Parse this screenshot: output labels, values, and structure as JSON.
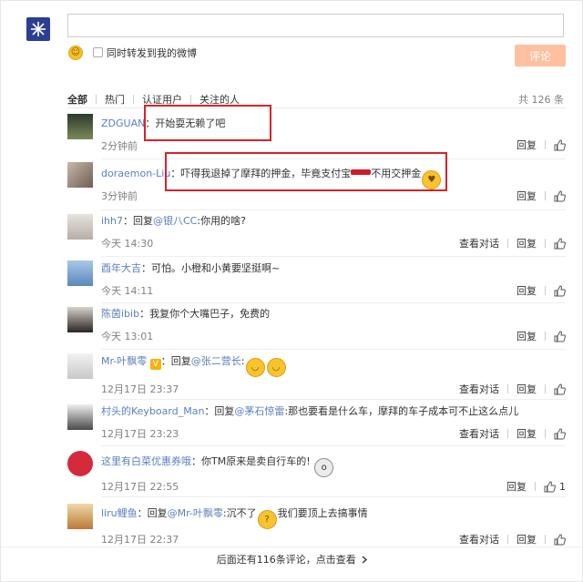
{
  "composer": {
    "textarea_value": "",
    "repost_label": "同时转发到我的微博",
    "repost_checked": false,
    "submit_label": "评论"
  },
  "tabs": [
    {
      "label": "全部"
    },
    {
      "label": "热门"
    },
    {
      "label": "认证用户"
    },
    {
      "label": "关注的人"
    }
  ],
  "total": "共 126 条",
  "reply_label": "回复",
  "conversation_label": "查看对话",
  "comments": [
    {
      "user": "ZDGUAN",
      "prefix": "：",
      "mention": "",
      "text": "开始耍无赖了吧",
      "time": "2分钟前",
      "has_conversation": false,
      "likes": ""
    },
    {
      "user": "doraemon-Liu",
      "prefix": "：",
      "mention": "",
      "text_a": "吓得我退掉了摩拜的押金，毕竟支付宝",
      "text_b": "不用交押金",
      "time": "3分钟前",
      "has_conversation": false,
      "likes": ""
    },
    {
      "user": "ihh7",
      "prefix": "：回复",
      "mention": "@银八CC",
      "text": ":你用的啥?",
      "time": "今天 14:30",
      "has_conversation": true,
      "likes": ""
    },
    {
      "user": "酉年大吉",
      "prefix": "：",
      "mention": "",
      "text": "可怕。小橙和小黄要坚挺啊~",
      "time": "今天 14:11",
      "has_conversation": false,
      "likes": ""
    },
    {
      "user": "陈茵ibib",
      "prefix": "：",
      "mention": "",
      "text": "我复你个大嘴巴子，免费的",
      "time": "今天 13:01",
      "has_conversation": false,
      "likes": ""
    },
    {
      "user": "Mr-叶飘零",
      "prefix": "：回复",
      "mention": "@张二营长",
      "text": ":",
      "time": "12月17日 23:37",
      "has_conversation": true,
      "likes": ""
    },
    {
      "user": "村头的Keyboard_Man",
      "prefix": "：回复",
      "mention": "@茅石惊雷",
      "text": ":那也要看是什么车，摩拜的车子成本可不止这么点儿",
      "time": "12月17日 23:23",
      "has_conversation": true,
      "likes": ""
    },
    {
      "user": "这里有白菜优惠券哦",
      "prefix": "：",
      "mention": "",
      "text": "你TM原来是卖自行车的!",
      "time": "12月17日 22:55",
      "has_conversation": false,
      "likes": "1"
    },
    {
      "user": "liru鲤鱼",
      "prefix": "：回复",
      "mention": "@Mr-叶飘零",
      "text_a": ":沉不了",
      "text_b": "我们要顶上去搞事情",
      "time": "12月17日 22:37",
      "has_conversation": true,
      "likes": ""
    }
  ],
  "more_label": "后面还有116条评论，点击查看",
  "colors": {
    "link": "#5b7fbd",
    "submit_disabled": "#ffc09f",
    "annotation": "#d8222a",
    "muted": "#808080"
  },
  "icons": [
    "emoji-icon",
    "like-icon",
    "chevron-right-icon",
    "vip-badge-icon"
  ]
}
